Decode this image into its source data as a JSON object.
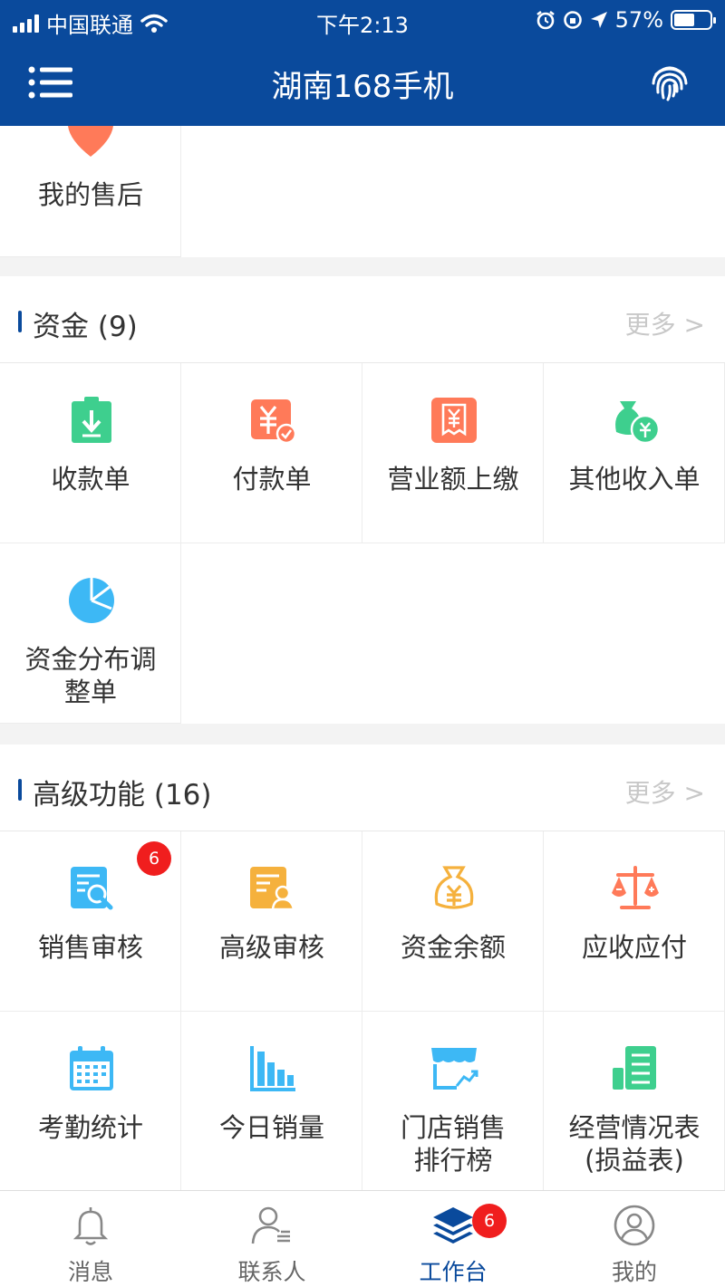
{
  "status_bar": {
    "carrier": "中国联通",
    "time": "下午2:13",
    "battery": "57%"
  },
  "header": {
    "title": "湖南168手机"
  },
  "after_sales": {
    "label": "我的售后"
  },
  "funds": {
    "title": "资金 (9)",
    "more": "更多 >",
    "items": [
      {
        "label": "收款单",
        "icon": "receipt-down-icon",
        "color": "#3ecf8e"
      },
      {
        "label": "付款单",
        "icon": "yuan-check-icon",
        "color": "#ff7a59"
      },
      {
        "label": "营业额上缴",
        "icon": "yuan-bill-icon",
        "color": "#ff7a59"
      },
      {
        "label": "其他收入单",
        "icon": "money-bag-icon",
        "color": "#3ecf8e"
      },
      {
        "label": "资金分布调\n整单",
        "icon": "pie-chart-icon",
        "color": "#3db8f5"
      }
    ]
  },
  "advanced": {
    "title": "高级功能 (16)",
    "more": "更多 >",
    "items": [
      {
        "label": "销售审核",
        "icon": "doc-search-icon",
        "color": "#3db8f5",
        "badge": "6"
      },
      {
        "label": "高级审核",
        "icon": "doc-user-icon",
        "color": "#f5b13d"
      },
      {
        "label": "资金余额",
        "icon": "yuan-bag-icon",
        "color": "#f5b13d"
      },
      {
        "label": "应收应付",
        "icon": "scale-icon",
        "color": "#ff7a59"
      },
      {
        "label": "考勤统计",
        "icon": "calendar-icon",
        "color": "#3db8f5"
      },
      {
        "label": "今日销量",
        "icon": "bar-chart-icon",
        "color": "#3db8f5"
      },
      {
        "label": "门店销售\n排行榜",
        "icon": "store-chart-icon",
        "color": "#3db8f5"
      },
      {
        "label": "经营情况表\n(损益表)",
        "icon": "ledger-icon",
        "color": "#3ecf8e"
      }
    ]
  },
  "tabbar": {
    "items": [
      {
        "label": "消息",
        "icon": "bell-icon"
      },
      {
        "label": "联系人",
        "icon": "contacts-icon"
      },
      {
        "label": "工作台",
        "icon": "layers-icon",
        "active": true,
        "badge": "6"
      },
      {
        "label": "我的",
        "icon": "profile-icon"
      }
    ]
  },
  "colors": {
    "primary": "#0a4a9c",
    "badge": "#f01e1e"
  }
}
